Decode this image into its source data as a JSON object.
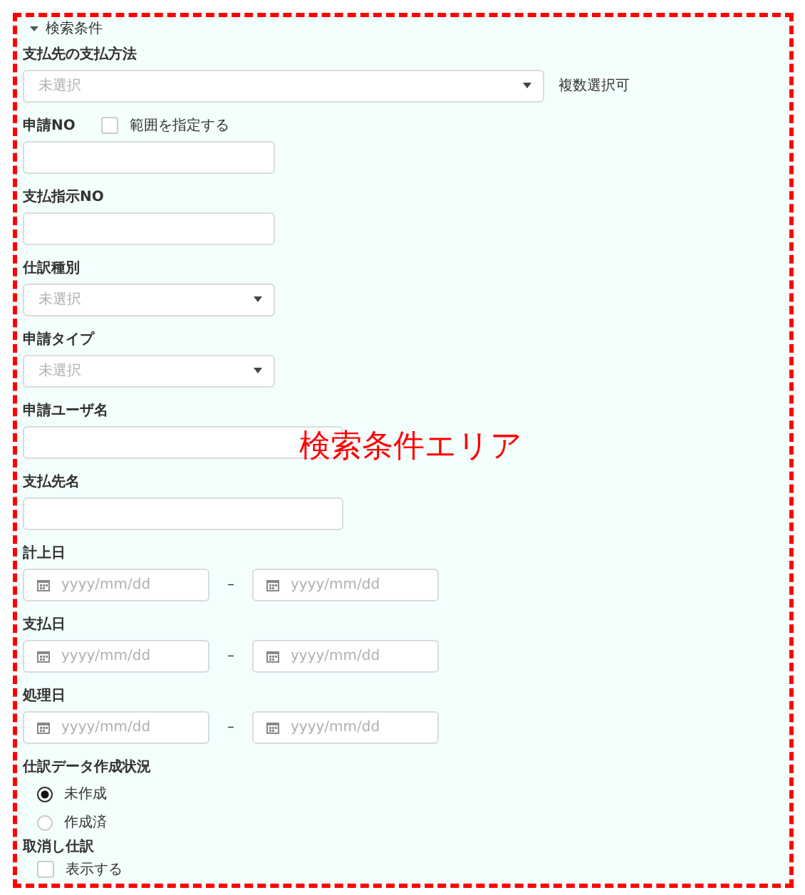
{
  "section": {
    "title": "検索条件",
    "expanded": true
  },
  "fields": [
    {
      "kind": "select",
      "label": "支払先の支払方法",
      "placeholder": "未選択",
      "note": "複数選択可"
    },
    {
      "kind": "text",
      "label": "申請NO",
      "range_option": {
        "label": "範囲を指定する",
        "checked": false
      }
    },
    {
      "kind": "text",
      "label": "支払指示NO"
    },
    {
      "kind": "select",
      "label": "仕訳種別",
      "placeholder": "未選択"
    },
    {
      "kind": "select",
      "label": "申請タイプ",
      "placeholder": "未選択"
    },
    {
      "kind": "text",
      "label": "申請ユーザ名"
    },
    {
      "kind": "text",
      "label": "支払先名"
    },
    {
      "kind": "date_range",
      "label": "計上日",
      "from_placeholder": "yyyy/mm/dd",
      "separator": "–",
      "to_placeholder": "yyyy/mm/dd"
    },
    {
      "kind": "date_range",
      "label": "支払日",
      "from_placeholder": "yyyy/mm/dd",
      "separator": "–",
      "to_placeholder": "yyyy/mm/dd"
    },
    {
      "kind": "date_range",
      "label": "処理日",
      "from_placeholder": "yyyy/mm/dd",
      "separator": "–",
      "to_placeholder": "yyyy/mm/dd"
    },
    {
      "kind": "radio",
      "label": "仕訳データ作成状況",
      "options": [
        {
          "label": "未作成",
          "selected": true
        },
        {
          "label": "作成済",
          "selected": false
        }
      ]
    },
    {
      "kind": "checkbox",
      "label": "取消し仕訳",
      "options": [
        {
          "label": "表示する",
          "checked": false
        }
      ]
    }
  ],
  "annotation": "検索条件エリア"
}
